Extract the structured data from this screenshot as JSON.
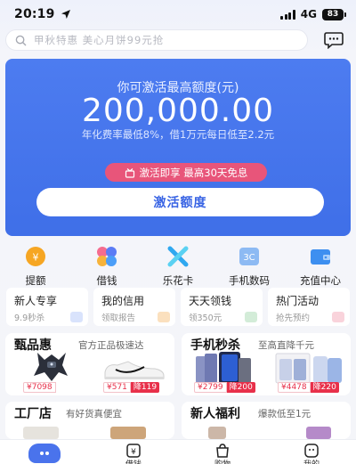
{
  "status_bar": {
    "time": "20:19",
    "network": "4G",
    "battery": "83"
  },
  "search": {
    "placeholder": "甲秋特惠 美心月饼99元抢"
  },
  "hero": {
    "label": "你可激活最高额度(元)",
    "amount": "200,000.00",
    "subtitle": "年化费率最低8%，借1万元每日低至2.2元",
    "promo": "激活即享 最高30天免息",
    "activate_button": "激活额度"
  },
  "quick_actions": [
    {
      "label": "提额",
      "icon": "coin-yen-icon",
      "color": "#f6a623"
    },
    {
      "label": "借钱",
      "icon": "clover-icon",
      "color": "#5b7cf5"
    },
    {
      "label": "乐花卡",
      "icon": "star-card-icon",
      "color": "#2fa8f0"
    },
    {
      "label": "手机数码",
      "icon": "3c-icon",
      "color": "#5aa6ee"
    },
    {
      "label": "充值中心",
      "icon": "wallet-icon",
      "color": "#3d8ff0"
    }
  ],
  "mini_cards": [
    {
      "title": "新人专享",
      "sub": "9.9秒杀"
    },
    {
      "title": "我的信用",
      "sub": "领取报告"
    },
    {
      "title": "天天领钱",
      "sub": "领350元"
    },
    {
      "title": "热门活动",
      "sub": "抢先预约"
    }
  ],
  "sections": {
    "left": {
      "title": "甄品惠",
      "subtitle": "官方正品极速达",
      "products": [
        {
          "price": "¥7098",
          "discount": ""
        },
        {
          "price": "¥571",
          "discount": "降119"
        }
      ]
    },
    "right": {
      "title": "手机秒杀",
      "subtitle": "至高直降千元",
      "products": [
        {
          "price": "¥2799",
          "discount": "降200"
        },
        {
          "price": "¥4478",
          "discount": "降220"
        }
      ]
    },
    "left2": {
      "title": "工厂店",
      "subtitle": "有好货真便宜"
    },
    "right2": {
      "title": "新人福利",
      "subtitle": "爆款低至1元"
    }
  },
  "bottom_nav": [
    {
      "label": "",
      "icon": "home-icon"
    },
    {
      "label": "借钱",
      "icon": "yen-doc-icon"
    },
    {
      "label": "购物",
      "icon": "shopping-bag-icon"
    },
    {
      "label": "我的",
      "icon": "profile-icon"
    }
  ],
  "colors": {
    "primary": "#4a73ec",
    "promo": "#e8557a",
    "price": "#e8304a"
  }
}
